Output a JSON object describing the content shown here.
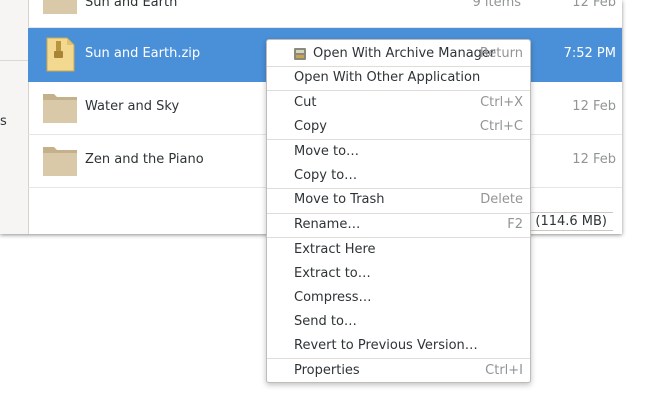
{
  "sidebar": {
    "partial_label": "s"
  },
  "files": [
    {
      "name": "Sun and Earth",
      "items": "9 items",
      "date": "12 Feb",
      "type": "folder"
    },
    {
      "name": "Sun and Earth.zip",
      "items": "",
      "date": "7:52 PM",
      "type": "archive",
      "selected": true
    },
    {
      "name": "Water and Sky",
      "items": "",
      "date": "12 Feb",
      "type": "folder"
    },
    {
      "name": "Zen and the Piano",
      "items": "",
      "date": "12 Feb",
      "type": "folder"
    }
  ],
  "statusbar": {
    "text": "ed (114.6 MB)"
  },
  "menu": {
    "items": [
      {
        "label": "Open With Archive Manager",
        "accel": "Return",
        "icon": "archive-manager-icon"
      },
      {
        "label": "Open With Other Application",
        "accel": ""
      },
      {
        "label": "Cut",
        "accel": "Ctrl+X"
      },
      {
        "label": "Copy",
        "accel": "Ctrl+C"
      },
      {
        "label": "Move to…",
        "accel": ""
      },
      {
        "label": "Copy to…",
        "accel": ""
      },
      {
        "label": "Move to Trash",
        "accel": "Delete"
      },
      {
        "label": "Rename…",
        "accel": "F2"
      },
      {
        "label": "Extract Here",
        "accel": ""
      },
      {
        "label": "Extract to…",
        "accel": ""
      },
      {
        "label": "Compress…",
        "accel": ""
      },
      {
        "label": "Send to…",
        "accel": ""
      },
      {
        "label": "Revert to Previous Version…",
        "accel": ""
      },
      {
        "label": "Properties",
        "accel": "Ctrl+I"
      }
    ]
  },
  "colors": {
    "selection": "#4a90d9",
    "folder": "#d9c9a8",
    "folder_dark": "#c4b08a"
  }
}
